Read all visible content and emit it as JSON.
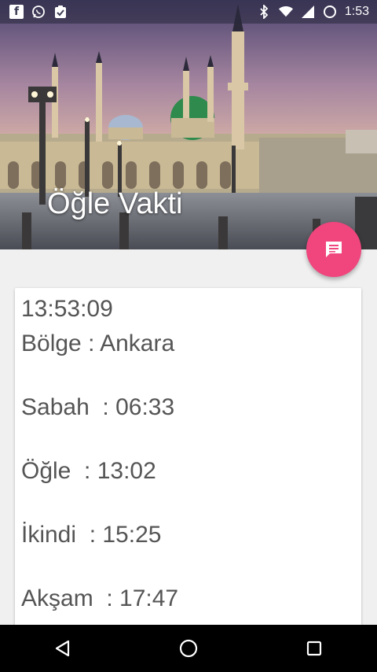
{
  "status_bar": {
    "left_icons": [
      "facebook-icon",
      "whatsapp-icon",
      "clipboard-check-icon"
    ],
    "right_icons": [
      "bluetooth-icon",
      "wifi-icon",
      "signal-icon",
      "battery-icon"
    ],
    "time": "1:53"
  },
  "header": {
    "title": "Öğle Vakti",
    "image": "mosque-photo"
  },
  "fab": {
    "icon": "message-icon",
    "color": "#f0457d"
  },
  "card": {
    "current_time": "13:53:09",
    "region": "Bölge : Ankara",
    "prayers": [
      {
        "label": "Sabah  : 06:33"
      },
      {
        "label": "Öğle  : 13:02"
      },
      {
        "label": "İkindi  : 15:25"
      },
      {
        "label": "Akşam  : 17:47"
      }
    ]
  },
  "nav_bar": {
    "buttons": [
      "back-icon",
      "home-icon",
      "recents-icon"
    ]
  }
}
